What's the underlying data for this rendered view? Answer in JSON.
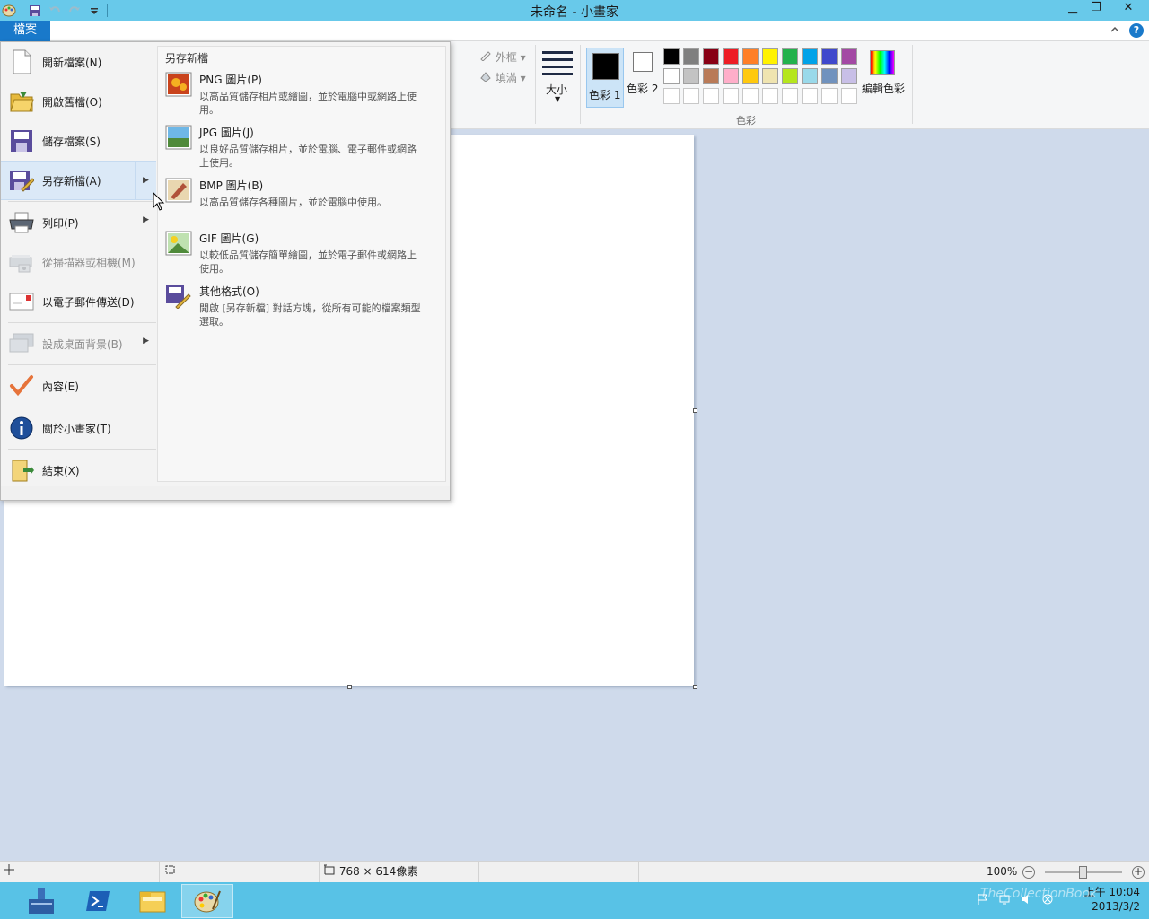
{
  "window": {
    "title": "未命名 - 小畫家",
    "controls": {
      "minimize": "▁",
      "restore": "❐",
      "close": "✕"
    }
  },
  "ribbon": {
    "file_tab": "檔案",
    "shapes": {
      "outline": "外框",
      "fill": "填滿"
    },
    "size_label": "大小",
    "color1_label": "色彩 1",
    "color2_label": "色彩 2",
    "colors_group_label": "色彩",
    "edit_colors_label": "編輯色彩",
    "palette_row1": [
      "#000000",
      "#7f7f7f",
      "#880015",
      "#ed1c24",
      "#ff7f27",
      "#fff200",
      "#22b14c",
      "#00a2e8",
      "#3f48cc",
      "#a349a4"
    ],
    "palette_row2": [
      "#ffffff",
      "#c3c3c3",
      "#b97a57",
      "#ffaec9",
      "#ffc90e",
      "#efe4b0",
      "#b5e61d",
      "#99d9ea",
      "#7092be",
      "#c8bfe7"
    ],
    "help": "?"
  },
  "file_menu": {
    "items": [
      {
        "label": "開新檔案(N)",
        "icon": "new-file-icon",
        "disabled": false,
        "has_submenu": false
      },
      {
        "label": "開啟舊檔(O)",
        "icon": "open-folder-icon",
        "disabled": false,
        "has_submenu": false
      },
      {
        "label": "儲存檔案(S)",
        "icon": "save-disk-icon",
        "disabled": false,
        "has_submenu": false
      },
      {
        "label": "另存新檔(A)",
        "icon": "save-as-icon",
        "disabled": false,
        "has_submenu": true,
        "active": true
      },
      {
        "label": "列印(P)",
        "icon": "printer-icon",
        "disabled": false,
        "has_submenu": true
      },
      {
        "label": "從掃描器或相機(M)",
        "icon": "scanner-icon",
        "disabled": true,
        "has_submenu": false
      },
      {
        "label": "以電子郵件傳送(D)",
        "icon": "email-icon",
        "disabled": false,
        "has_submenu": false
      },
      {
        "label": "設成桌面背景(B)",
        "icon": "desktop-background-icon",
        "disabled": true,
        "has_submenu": true
      },
      {
        "label": "內容(E)",
        "icon": "checkmark-icon",
        "disabled": false,
        "has_submenu": false
      },
      {
        "label": "關於小畫家(T)",
        "icon": "info-icon",
        "disabled": false,
        "has_submenu": false
      },
      {
        "label": "結束(X)",
        "icon": "exit-folder-icon",
        "disabled": false,
        "has_submenu": false
      }
    ],
    "submenu": {
      "title": "另存新檔",
      "items": [
        {
          "title": "PNG 圖片(P)",
          "desc": "以高品質儲存相片或繪圖，並於電腦中或網路上使用。",
          "icon": "png-image-icon"
        },
        {
          "title": "JPG 圖片(J)",
          "desc": "以良好品質儲存相片，並於電腦、電子郵件或網路上使用。",
          "icon": "jpg-image-icon"
        },
        {
          "title": "BMP 圖片(B)",
          "desc": "以高品質儲存各種圖片，並於電腦中使用。",
          "icon": "bmp-image-icon"
        },
        {
          "title": "GIF 圖片(G)",
          "desc": "以較低品質儲存簡單繪圖，並於電子郵件或網路上使用。",
          "icon": "gif-image-icon"
        },
        {
          "title": "其他格式(O)",
          "desc": "開啟 [另存新檔] 對話方塊，從所有可能的檔案類型選取。",
          "icon": "other-formats-icon"
        }
      ]
    }
  },
  "statusbar": {
    "dimensions": "768 × 614像素",
    "zoom": "100%",
    "zoom_out": "−",
    "zoom_in": "+"
  },
  "taskbar": {
    "apps": [
      "server-manager-icon",
      "powershell-icon",
      "file-explorer-icon",
      "paint-icon"
    ],
    "time": "上午 10:04",
    "date": "2013/3/2",
    "watermark": "TheCollectionBook"
  }
}
